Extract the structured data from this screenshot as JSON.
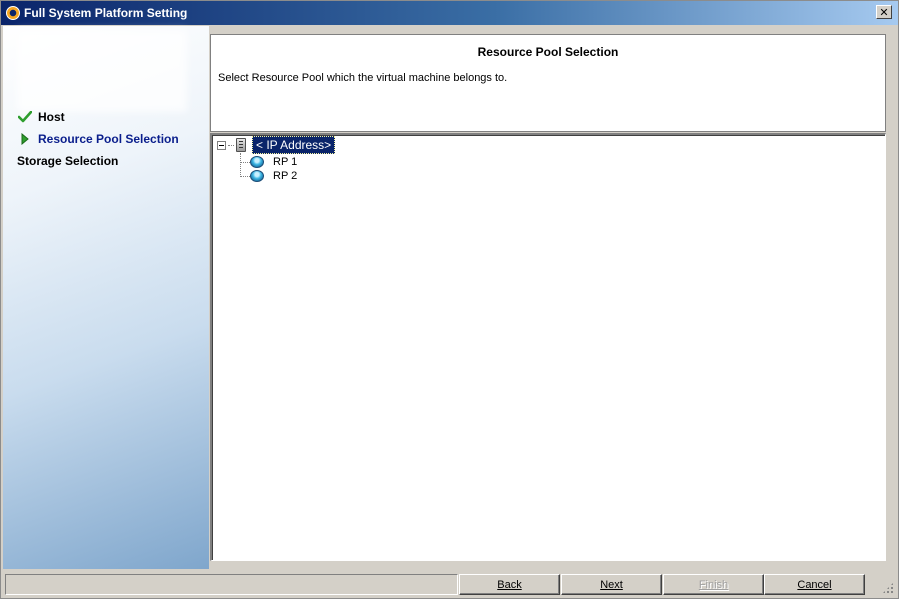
{
  "window": {
    "title": "Full System Platform Setting",
    "close_glyph": "✕"
  },
  "steps": [
    {
      "label": "Host",
      "state": "done",
      "icon": "check-icon"
    },
    {
      "label": "Resource Pool Selection",
      "state": "active",
      "icon": "arrow-right-icon"
    },
    {
      "label": "Storage Selection",
      "state": "pending",
      "icon": ""
    }
  ],
  "header": {
    "title": "Resource Pool Selection",
    "description": "Select Resource Pool which the virtual machine belongs to."
  },
  "tree": {
    "root": {
      "label": "< IP Address>",
      "icon": "server-icon",
      "expanded": true,
      "selected": true
    },
    "children": [
      {
        "label": "RP 1",
        "icon": "resource-pool-icon"
      },
      {
        "label": "RP 2",
        "icon": "resource-pool-icon"
      }
    ]
  },
  "status": {
    "text": ""
  },
  "buttons": {
    "back": "Back",
    "next": "Next",
    "finish": "Finish",
    "cancel": "Cancel"
  },
  "colors": {
    "title_gradient_start": "#0a246a",
    "active_step": "#0a1e8c",
    "selection": "#0a246a",
    "check": "#2e9e2e"
  }
}
